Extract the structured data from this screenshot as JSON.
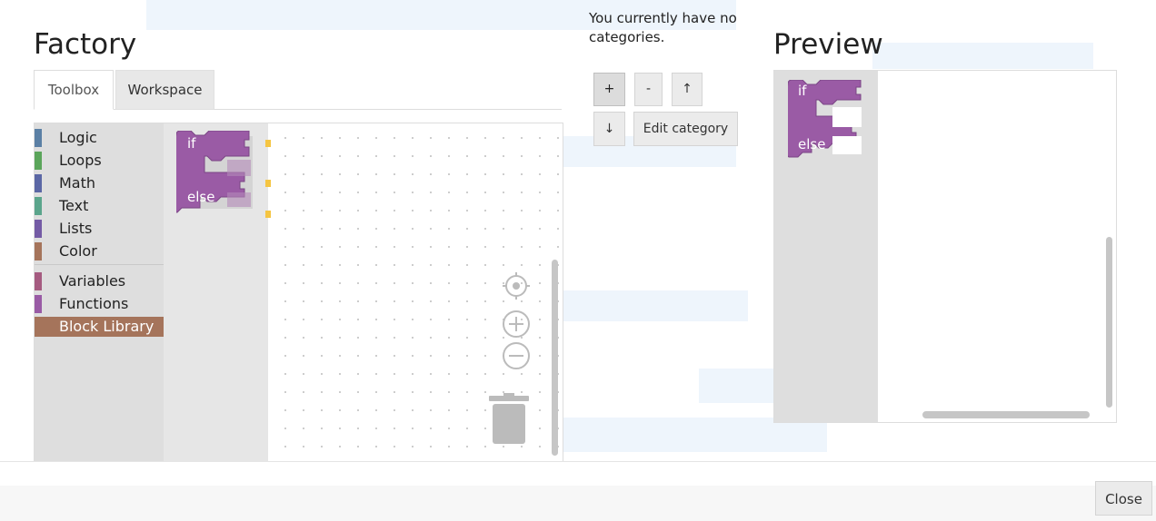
{
  "factory": {
    "title": "Factory",
    "tabs": [
      {
        "label": "Toolbox",
        "active": true
      },
      {
        "label": "Workspace",
        "active": false
      }
    ],
    "toolbox": {
      "categories": [
        {
          "label": "Logic",
          "color": "#5b80a5"
        },
        {
          "label": "Loops",
          "color": "#5ba55b"
        },
        {
          "label": "Math",
          "color": "#5b67a5"
        },
        {
          "label": "Text",
          "color": "#5ba58c"
        },
        {
          "label": "Lists",
          "color": "#745ba5"
        },
        {
          "label": "Color",
          "color": "#a5745b"
        },
        {
          "label": "Variables",
          "color": "#a55b80"
        },
        {
          "label": "Functions",
          "color": "#995ba5"
        },
        {
          "label": "Block Library",
          "color": "#a5745b",
          "selected": true
        }
      ]
    },
    "block": {
      "if_label": "if",
      "else_label": "else",
      "color": "#9a5ba5"
    }
  },
  "categories": {
    "message": "You currently have no categories.",
    "buttons": {
      "add": "+",
      "remove": "-",
      "up": "↑",
      "down": "↓",
      "edit": "Edit category"
    }
  },
  "preview": {
    "title": "Preview",
    "block": {
      "if_label": "if",
      "else_label": "else",
      "color": "#9a5ba5"
    }
  },
  "icons": {
    "center": "target-icon",
    "zoom_in": "zoom-in-icon",
    "zoom_out": "zoom-out-icon",
    "trash": "trash-icon"
  },
  "dialog": {
    "close_label": "Close"
  }
}
